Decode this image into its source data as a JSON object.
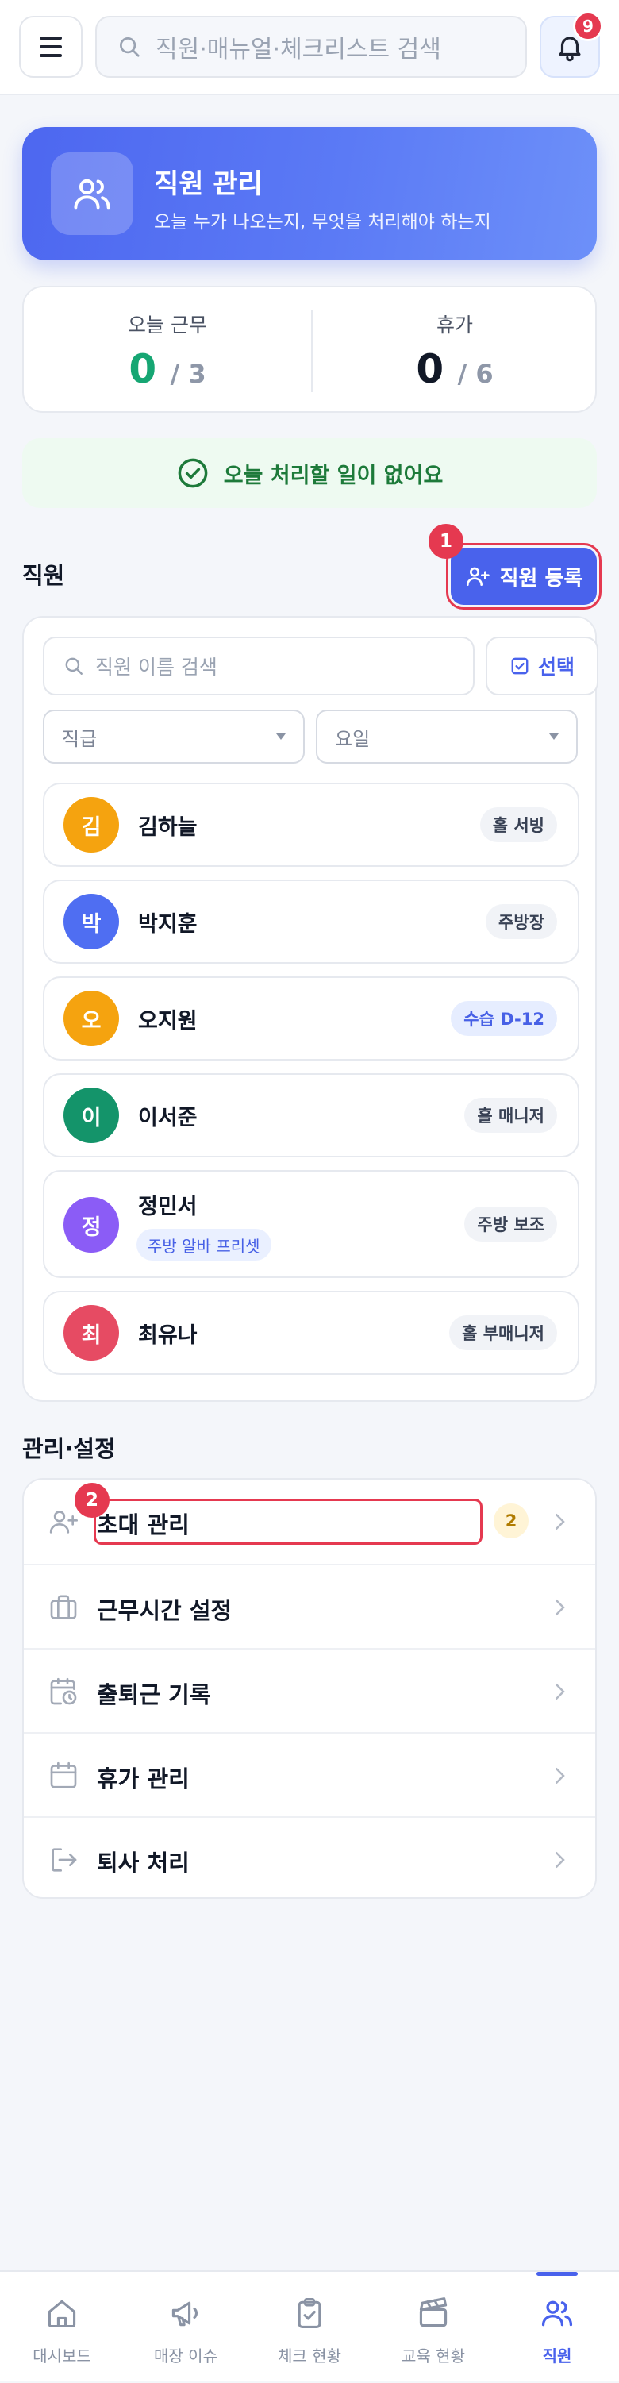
{
  "header": {
    "search_placeholder": "직원·매뉴얼·체크리스트 검색",
    "notification_count": "9"
  },
  "hero": {
    "title": "직원 관리",
    "subtitle": "오늘 누가 나오는지, 무엇을 처리해야 하는지"
  },
  "stats": {
    "work": {
      "label": "오늘 근무",
      "value": "0",
      "total": "/ 3",
      "color": "#16a673"
    },
    "leave": {
      "label": "휴가",
      "value": "0",
      "total": "/ 6",
      "color": "#111827"
    }
  },
  "notice": {
    "text": "오늘 처리할 일이 없어요"
  },
  "staff": {
    "section_title": "직원",
    "add_button": "직원 등록",
    "marker": "1",
    "search_placeholder": "직원 이름 검색",
    "select_button": "선택",
    "filters": [
      {
        "label": "직급"
      },
      {
        "label": "요일"
      }
    ],
    "employees": [
      {
        "initial": "김",
        "name": "김하늘",
        "role": "홀 서빙",
        "avatar_color": "#f5a30f"
      },
      {
        "initial": "박",
        "name": "박지훈",
        "role": "주방장",
        "avatar_color": "#4f6ef2"
      },
      {
        "initial": "오",
        "name": "오지원",
        "role": "수습 D-12",
        "avatar_color": "#f5a30f"
      },
      {
        "initial": "이",
        "name": "이서준",
        "role": "홀 매니저",
        "avatar_color": "#14946a"
      },
      {
        "initial": "정",
        "name": "정민서",
        "role": "주방 보조",
        "tag": "주방 알바 프리셋",
        "avatar_color": "#8b5cf6"
      },
      {
        "initial": "최",
        "name": "최유나",
        "role": "홀 부매니저",
        "avatar_color": "#e64b63"
      }
    ]
  },
  "manage": {
    "section_title": "관리·설정",
    "marker": "2",
    "items": [
      {
        "label": "초대 관리",
        "icon": "user-plus-icon",
        "badge": "2"
      },
      {
        "label": "근무시간 설정",
        "icon": "briefcase-icon"
      },
      {
        "label": "출퇴근 기록",
        "icon": "calendar-clock-icon"
      },
      {
        "label": "휴가 관리",
        "icon": "calendar-icon"
      },
      {
        "label": "퇴사 처리",
        "icon": "logout-icon"
      }
    ]
  },
  "nav": {
    "items": [
      {
        "label": "대시보드",
        "icon": "home-icon"
      },
      {
        "label": "매장 이슈",
        "icon": "megaphone-icon"
      },
      {
        "label": "체크 현황",
        "icon": "clipboard-check-icon"
      },
      {
        "label": "교육 현황",
        "icon": "clapperboard-icon"
      },
      {
        "label": "직원",
        "icon": "users-icon",
        "active": true
      }
    ]
  },
  "colors": {
    "accent": "#4962ec",
    "marker": "#e53950"
  }
}
